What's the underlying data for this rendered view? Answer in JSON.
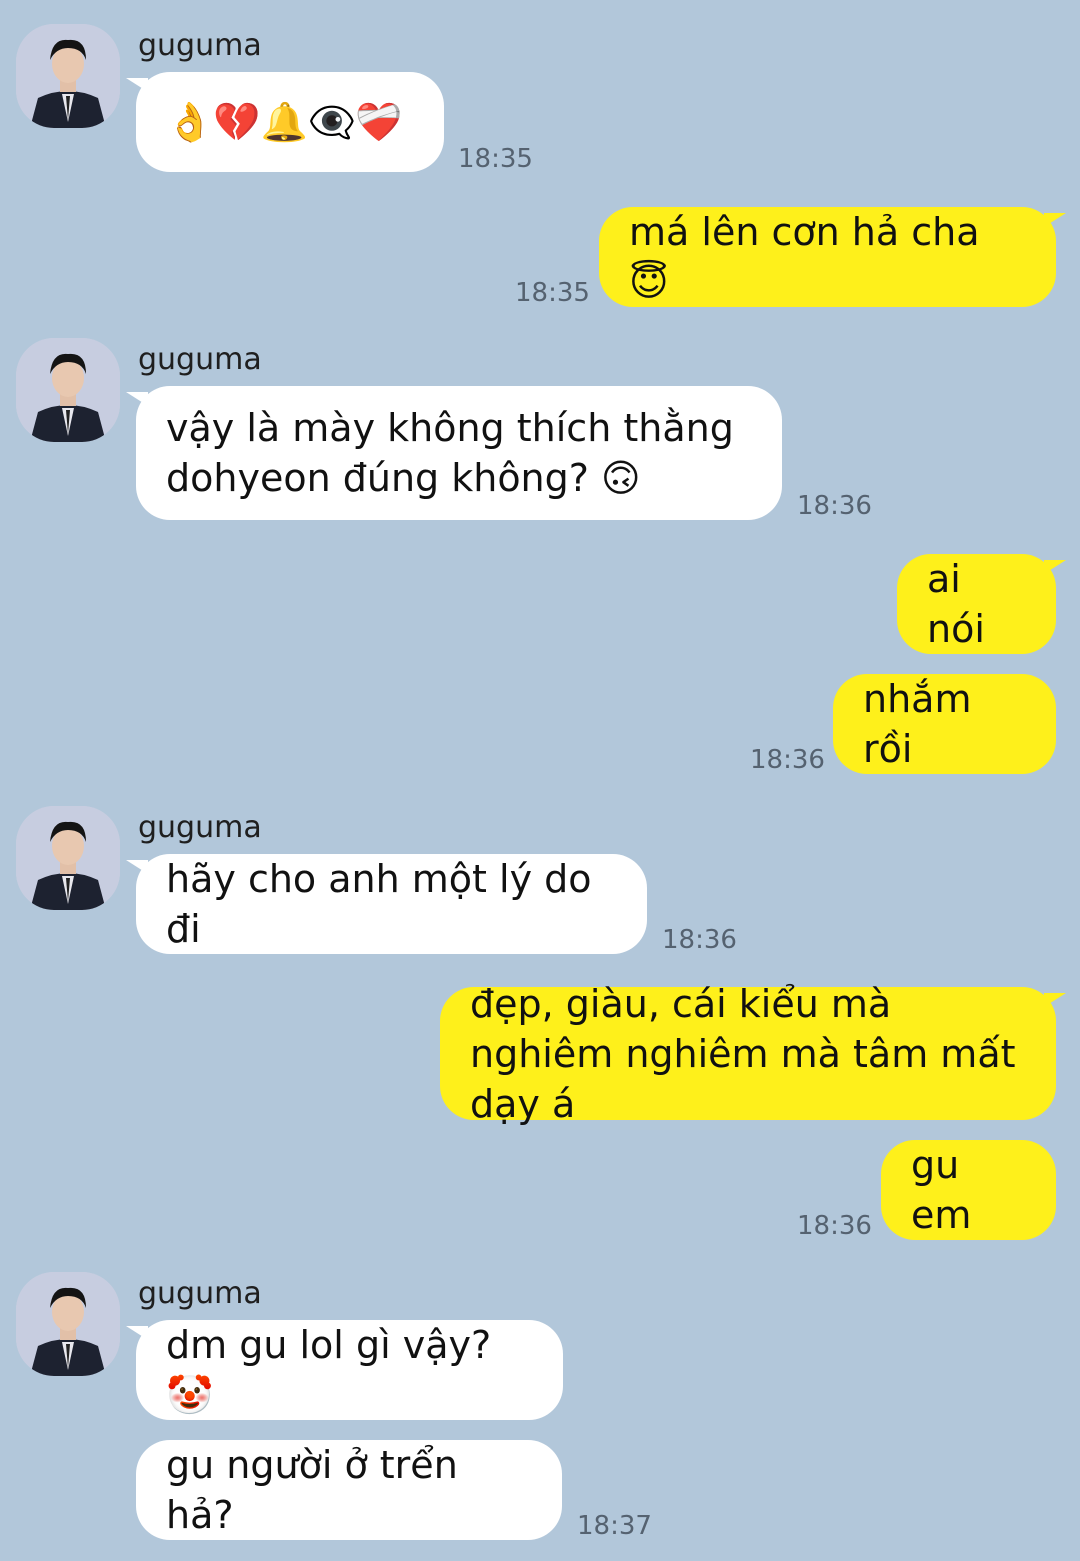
{
  "sender_name": "guguma",
  "messages": [
    {
      "dir": "in",
      "text": "👌💔🔔👁️‍🗨️❤️‍🩹",
      "time": "18:35"
    },
    {
      "dir": "out",
      "text": "má lên cơn hả cha 😇",
      "time": "18:35"
    },
    {
      "dir": "in",
      "text": "vậy là mày không thích thằng dohyeon đúng không? 🙃",
      "time": "18:36"
    },
    {
      "dir": "out",
      "text": "ai nói",
      "time": ""
    },
    {
      "dir": "out",
      "text": "nhắm rồi",
      "time": "18:36"
    },
    {
      "dir": "in",
      "text": "hãy cho anh một lý do đi",
      "time": "18:36"
    },
    {
      "dir": "out",
      "text": "đẹp, giàu, cái kiểu mà nghiêm nghiêm mà tâm mất dạy á",
      "time": ""
    },
    {
      "dir": "out",
      "text": "gu em",
      "time": "18:36"
    },
    {
      "dir": "in",
      "text": "dm gu lol gì vậy? 🤡",
      "time": ""
    },
    {
      "dir": "in",
      "text": "gu người ở trển hả?",
      "time": "18:37"
    }
  ],
  "colors": {
    "background": "#b2c7da",
    "incoming_bubble": "#ffffff",
    "outgoing_bubble": "#fef01b"
  }
}
